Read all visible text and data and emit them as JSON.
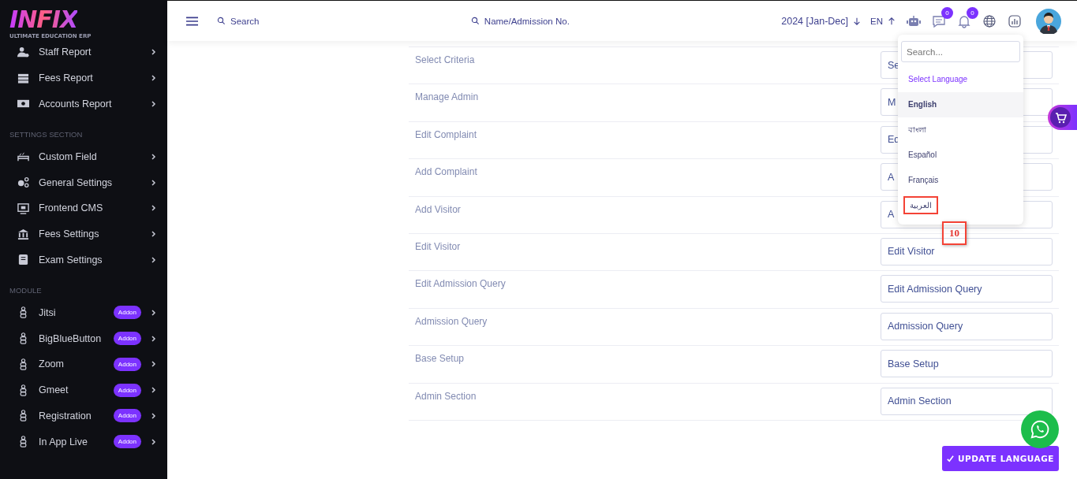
{
  "logo": {
    "name": "INFIX",
    "tagline": "ULTIMATE EDUCATION ERP"
  },
  "sidebar": {
    "sections": [
      {
        "items": [
          {
            "label": "Staff Report"
          },
          {
            "label": "Fees Report"
          },
          {
            "label": "Accounts Report"
          }
        ]
      },
      {
        "heading": "SETTINGS SECTION",
        "items": [
          {
            "label": "Custom Field"
          },
          {
            "label": "General Settings"
          },
          {
            "label": "Frontend CMS"
          },
          {
            "label": "Fees Settings"
          },
          {
            "label": "Exam Settings"
          }
        ]
      },
      {
        "heading": "MODULE",
        "items": [
          {
            "label": "Jitsi",
            "badge": "Addon"
          },
          {
            "label": "BigBlueButton",
            "badge": "Addon"
          },
          {
            "label": "Zoom",
            "badge": "Addon"
          },
          {
            "label": "Gmeet",
            "badge": "Addon"
          },
          {
            "label": "Registration",
            "badge": "Addon"
          },
          {
            "label": "In App Live",
            "badge": "Addon"
          }
        ]
      }
    ]
  },
  "header": {
    "search": "Search",
    "student_search": "Name/Admission No.",
    "session": "2024 [Jan-Dec]",
    "language_code": "EN",
    "chat_count": "0",
    "notification_count": "0"
  },
  "rows": [
    {
      "label": "Select Criteria",
      "value": "Se"
    },
    {
      "label": "Manage Admin",
      "value": "M"
    },
    {
      "label": "Edit Complaint",
      "value": "Ed"
    },
    {
      "label": "Add Complaint",
      "value": "A"
    },
    {
      "label": "Add Visitor",
      "value": "A"
    },
    {
      "label": "Edit Visitor",
      "value": "Edit Visitor"
    },
    {
      "label": "Edit Admission Query",
      "value": "Edit Admission Query"
    },
    {
      "label": "Admission Query",
      "value": "Admission Query"
    },
    {
      "label": "Base Setup",
      "value": "Base Setup"
    },
    {
      "label": "Admin Section",
      "value": "Admin Section"
    }
  ],
  "language_menu": {
    "placeholder": "Search...",
    "heading": "Select Language",
    "options": [
      {
        "label": "English",
        "selected": true,
        "highlighted": false
      },
      {
        "label": "বাংলা",
        "selected": false,
        "highlighted": false
      },
      {
        "label": "Español",
        "selected": false,
        "highlighted": false
      },
      {
        "label": "Français",
        "selected": false,
        "highlighted": false
      },
      {
        "label": "العربية",
        "selected": false,
        "highlighted": true
      }
    ]
  },
  "annotation": {
    "label": "10"
  },
  "update_button": "UPDATE LANGUAGE"
}
